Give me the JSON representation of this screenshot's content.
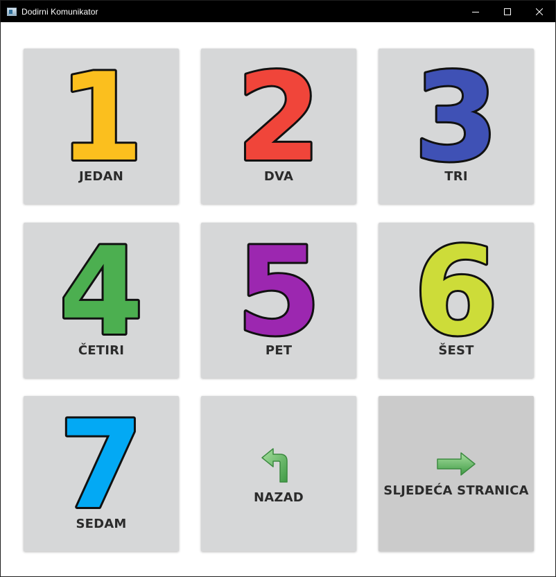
{
  "window": {
    "title": "Dodirni Komunikator",
    "controls": [
      "minimize-icon",
      "maximize-icon",
      "close-icon"
    ]
  },
  "tiles": [
    {
      "label": "JEDAN",
      "icon": "number-1-icon",
      "color": "#fbbf1e"
    },
    {
      "label": "DVA",
      "icon": "number-2-icon",
      "color": "#f0453a"
    },
    {
      "label": "TRI",
      "icon": "number-3-icon",
      "color": "#3f51b5"
    },
    {
      "label": "ČETIRI",
      "icon": "number-4-icon",
      "color": "#4caf50"
    },
    {
      "label": "PET",
      "icon": "number-5-icon",
      "color": "#9c27b0"
    },
    {
      "label": "ŠEST",
      "icon": "number-6-icon",
      "color": "#cddc39"
    },
    {
      "label": "SEDAM",
      "icon": "number-7-icon",
      "color": "#03a9f4"
    },
    {
      "label": "NAZAD",
      "icon": "back-arrow-icon",
      "color": "#6abf69"
    },
    {
      "label": "SLJEDEĆA STRANICA",
      "icon": "next-arrow-icon",
      "color": "#6abf69"
    }
  ]
}
